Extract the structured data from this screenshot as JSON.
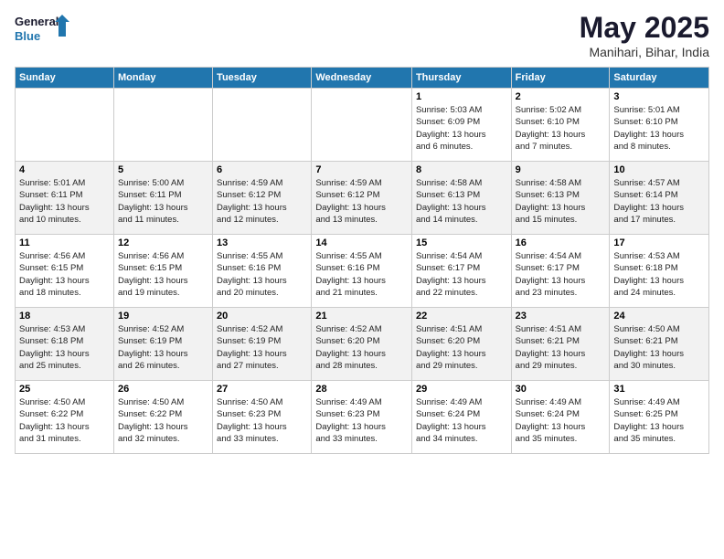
{
  "logo": {
    "line1": "General",
    "line2": "Blue"
  },
  "title": "May 2025",
  "location": "Manihari, Bihar, India",
  "weekdays": [
    "Sunday",
    "Monday",
    "Tuesday",
    "Wednesday",
    "Thursday",
    "Friday",
    "Saturday"
  ],
  "weeks": [
    [
      {
        "day": "",
        "info": ""
      },
      {
        "day": "",
        "info": ""
      },
      {
        "day": "",
        "info": ""
      },
      {
        "day": "",
        "info": ""
      },
      {
        "day": "1",
        "info": "Sunrise: 5:03 AM\nSunset: 6:09 PM\nDaylight: 13 hours\nand 6 minutes."
      },
      {
        "day": "2",
        "info": "Sunrise: 5:02 AM\nSunset: 6:10 PM\nDaylight: 13 hours\nand 7 minutes."
      },
      {
        "day": "3",
        "info": "Sunrise: 5:01 AM\nSunset: 6:10 PM\nDaylight: 13 hours\nand 8 minutes."
      }
    ],
    [
      {
        "day": "4",
        "info": "Sunrise: 5:01 AM\nSunset: 6:11 PM\nDaylight: 13 hours\nand 10 minutes."
      },
      {
        "day": "5",
        "info": "Sunrise: 5:00 AM\nSunset: 6:11 PM\nDaylight: 13 hours\nand 11 minutes."
      },
      {
        "day": "6",
        "info": "Sunrise: 4:59 AM\nSunset: 6:12 PM\nDaylight: 13 hours\nand 12 minutes."
      },
      {
        "day": "7",
        "info": "Sunrise: 4:59 AM\nSunset: 6:12 PM\nDaylight: 13 hours\nand 13 minutes."
      },
      {
        "day": "8",
        "info": "Sunrise: 4:58 AM\nSunset: 6:13 PM\nDaylight: 13 hours\nand 14 minutes."
      },
      {
        "day": "9",
        "info": "Sunrise: 4:58 AM\nSunset: 6:13 PM\nDaylight: 13 hours\nand 15 minutes."
      },
      {
        "day": "10",
        "info": "Sunrise: 4:57 AM\nSunset: 6:14 PM\nDaylight: 13 hours\nand 17 minutes."
      }
    ],
    [
      {
        "day": "11",
        "info": "Sunrise: 4:56 AM\nSunset: 6:15 PM\nDaylight: 13 hours\nand 18 minutes."
      },
      {
        "day": "12",
        "info": "Sunrise: 4:56 AM\nSunset: 6:15 PM\nDaylight: 13 hours\nand 19 minutes."
      },
      {
        "day": "13",
        "info": "Sunrise: 4:55 AM\nSunset: 6:16 PM\nDaylight: 13 hours\nand 20 minutes."
      },
      {
        "day": "14",
        "info": "Sunrise: 4:55 AM\nSunset: 6:16 PM\nDaylight: 13 hours\nand 21 minutes."
      },
      {
        "day": "15",
        "info": "Sunrise: 4:54 AM\nSunset: 6:17 PM\nDaylight: 13 hours\nand 22 minutes."
      },
      {
        "day": "16",
        "info": "Sunrise: 4:54 AM\nSunset: 6:17 PM\nDaylight: 13 hours\nand 23 minutes."
      },
      {
        "day": "17",
        "info": "Sunrise: 4:53 AM\nSunset: 6:18 PM\nDaylight: 13 hours\nand 24 minutes."
      }
    ],
    [
      {
        "day": "18",
        "info": "Sunrise: 4:53 AM\nSunset: 6:18 PM\nDaylight: 13 hours\nand 25 minutes."
      },
      {
        "day": "19",
        "info": "Sunrise: 4:52 AM\nSunset: 6:19 PM\nDaylight: 13 hours\nand 26 minutes."
      },
      {
        "day": "20",
        "info": "Sunrise: 4:52 AM\nSunset: 6:19 PM\nDaylight: 13 hours\nand 27 minutes."
      },
      {
        "day": "21",
        "info": "Sunrise: 4:52 AM\nSunset: 6:20 PM\nDaylight: 13 hours\nand 28 minutes."
      },
      {
        "day": "22",
        "info": "Sunrise: 4:51 AM\nSunset: 6:20 PM\nDaylight: 13 hours\nand 29 minutes."
      },
      {
        "day": "23",
        "info": "Sunrise: 4:51 AM\nSunset: 6:21 PM\nDaylight: 13 hours\nand 29 minutes."
      },
      {
        "day": "24",
        "info": "Sunrise: 4:50 AM\nSunset: 6:21 PM\nDaylight: 13 hours\nand 30 minutes."
      }
    ],
    [
      {
        "day": "25",
        "info": "Sunrise: 4:50 AM\nSunset: 6:22 PM\nDaylight: 13 hours\nand 31 minutes."
      },
      {
        "day": "26",
        "info": "Sunrise: 4:50 AM\nSunset: 6:22 PM\nDaylight: 13 hours\nand 32 minutes."
      },
      {
        "day": "27",
        "info": "Sunrise: 4:50 AM\nSunset: 6:23 PM\nDaylight: 13 hours\nand 33 minutes."
      },
      {
        "day": "28",
        "info": "Sunrise: 4:49 AM\nSunset: 6:23 PM\nDaylight: 13 hours\nand 33 minutes."
      },
      {
        "day": "29",
        "info": "Sunrise: 4:49 AM\nSunset: 6:24 PM\nDaylight: 13 hours\nand 34 minutes."
      },
      {
        "day": "30",
        "info": "Sunrise: 4:49 AM\nSunset: 6:24 PM\nDaylight: 13 hours\nand 35 minutes."
      },
      {
        "day": "31",
        "info": "Sunrise: 4:49 AM\nSunset: 6:25 PM\nDaylight: 13 hours\nand 35 minutes."
      }
    ]
  ]
}
